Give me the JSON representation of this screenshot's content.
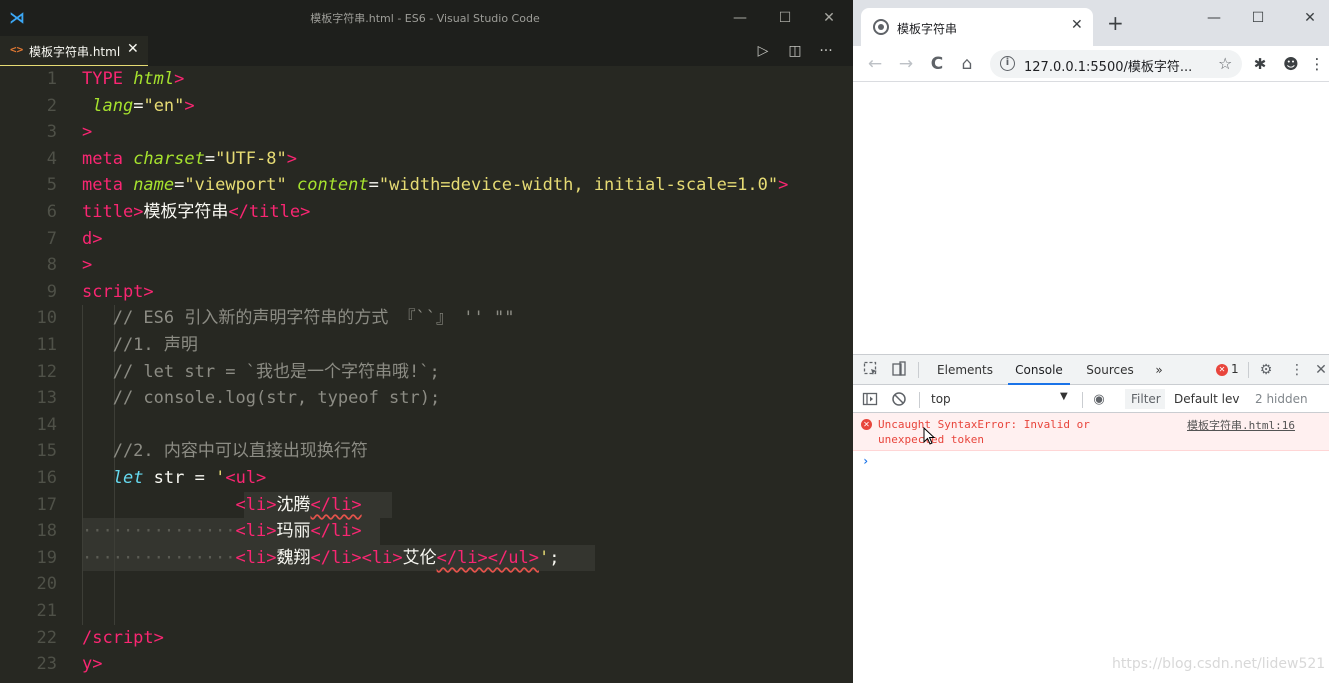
{
  "vscode": {
    "window_title": "模板字符串.html - ES6 - Visual Studio Code",
    "logo_glyph": "⋊",
    "controls": {
      "minimize": "—",
      "maximize": "☐",
      "close": "✕"
    },
    "tab": {
      "icon": "<>",
      "label": "模板字符串.html",
      "close": "✕"
    },
    "actions": {
      "run": "▷",
      "split": "◫",
      "more": "···"
    },
    "lines": [
      {
        "n": "1",
        "parts": [
          [
            "tag",
            "TYPE "
          ],
          [
            "attr",
            "html"
          ],
          [
            "tag",
            ">"
          ]
        ]
      },
      {
        "n": "2",
        "parts": [
          [
            "pl",
            " "
          ],
          [
            "attr",
            "lang"
          ],
          [
            "pl",
            "="
          ],
          [
            "str",
            "\"en\""
          ],
          [
            "tag",
            ">"
          ]
        ]
      },
      {
        "n": "3",
        "parts": [
          [
            "tag",
            ">"
          ]
        ]
      },
      {
        "n": "4",
        "parts": [
          [
            "tag",
            "meta "
          ],
          [
            "attr",
            "charset"
          ],
          [
            "pl",
            "="
          ],
          [
            "str",
            "\"UTF-8\""
          ],
          [
            "tag",
            ">"
          ]
        ]
      },
      {
        "n": "5",
        "parts": [
          [
            "tag",
            "meta "
          ],
          [
            "attr",
            "name"
          ],
          [
            "pl",
            "="
          ],
          [
            "str",
            "\"viewport\" "
          ],
          [
            "attr",
            "content"
          ],
          [
            "pl",
            "="
          ],
          [
            "str",
            "\"width=device-width, initial-scale=1.0\""
          ],
          [
            "tag",
            ">"
          ]
        ]
      },
      {
        "n": "6",
        "parts": [
          [
            "tag",
            "title"
          ],
          [
            "tag",
            ">"
          ],
          [
            "pl",
            "模板字符串"
          ],
          [
            "tag",
            "</title>"
          ]
        ]
      },
      {
        "n": "7",
        "parts": [
          [
            "tag",
            "d>"
          ]
        ]
      },
      {
        "n": "8",
        "parts": [
          [
            "tag",
            ">"
          ]
        ]
      },
      {
        "n": "9",
        "parts": [
          [
            "tag",
            "script>"
          ]
        ]
      },
      {
        "n": "10",
        "parts": [
          [
            "cm",
            "   // ES6 引入新的声明字符串的方式 『``』 '' \"\""
          ]
        ]
      },
      {
        "n": "11",
        "parts": [
          [
            "cm",
            "   //1. 声明"
          ]
        ]
      },
      {
        "n": "12",
        "parts": [
          [
            "cm",
            "   // let str = `我也是一个字符串哦!`;"
          ]
        ]
      },
      {
        "n": "13",
        "parts": [
          [
            "cm",
            "   // console.log(str, typeof str);"
          ]
        ]
      },
      {
        "n": "14",
        "parts": []
      },
      {
        "n": "15",
        "parts": [
          [
            "cm",
            "   //2. 内容中可以直接出现换行符"
          ]
        ]
      },
      {
        "n": "16",
        "parts": [
          [
            "pl",
            "   "
          ],
          [
            "kw",
            "let"
          ],
          [
            "pl",
            " str = "
          ],
          [
            "str",
            "'"
          ],
          [
            "tag",
            "<ul>"
          ]
        ]
      },
      {
        "n": "17",
        "parts": [
          [
            "pl",
            "               "
          ],
          [
            "tag",
            "<li>"
          ],
          [
            "pl",
            "沈腾"
          ],
          [
            "tag",
            "</li>"
          ]
        ]
      },
      {
        "n": "18",
        "parts": [
          [
            "dots",
            "···············"
          ],
          [
            "tag",
            "<li>"
          ],
          [
            "pl",
            "玛丽"
          ],
          [
            "tag",
            "</li>"
          ]
        ]
      },
      {
        "n": "19",
        "parts": [
          [
            "dots",
            "···············"
          ],
          [
            "tag",
            "<li>"
          ],
          [
            "pl",
            "魏翔"
          ],
          [
            "tag",
            "</li><li>"
          ],
          [
            "pl",
            "艾伦"
          ],
          [
            "tag",
            "</li></ul>"
          ],
          [
            "str",
            "'"
          ],
          [
            "pl",
            ";"
          ]
        ]
      },
      {
        "n": "20",
        "parts": []
      },
      {
        "n": "21",
        "parts": []
      },
      {
        "n": "22",
        "parts": [
          [
            "tag",
            "/script>"
          ]
        ]
      },
      {
        "n": "23",
        "parts": [
          [
            "tag",
            "y>"
          ]
        ]
      }
    ]
  },
  "chrome": {
    "tab_title": "模板字符串",
    "tab_close": "✕",
    "new_tab": "+",
    "controls": {
      "minimize": "—",
      "maximize": "☐",
      "close": "✕"
    },
    "nav": {
      "back": "←",
      "forward": "→",
      "reload": "C",
      "home": "⌂"
    },
    "info_glyph": "i",
    "url": "127.0.0.1:5500/模板字符...",
    "star": "☆",
    "extensions": {
      "puzzle": "✱",
      "avatar": "☻",
      "menu": "⋮"
    }
  },
  "devtools": {
    "tabs": [
      "Elements",
      "Console",
      "Sources"
    ],
    "more_tabs": "»",
    "error_count": "1",
    "settings": "⚙",
    "kebab": "⋮",
    "close": "✕",
    "context": "top",
    "context_arrow": "▼",
    "eye": "◉",
    "filter_placeholder": "Filter",
    "levels": "Default lev",
    "hidden": "2 hidden",
    "error": {
      "message": "Uncaught SyntaxError: Invalid or unexpected token",
      "source": "模板字符串.html:16"
    },
    "prompt": "›"
  },
  "watermark": "https://blog.csdn.net/lidew521",
  "colors": {
    "editor_bg": "#272822",
    "tag": "#f92672",
    "attr": "#a6e22e",
    "string": "#e6db74",
    "keyword": "#66d9ef",
    "comment": "#8c8c84",
    "error": "#e8453c",
    "accent": "#1a73e8"
  }
}
